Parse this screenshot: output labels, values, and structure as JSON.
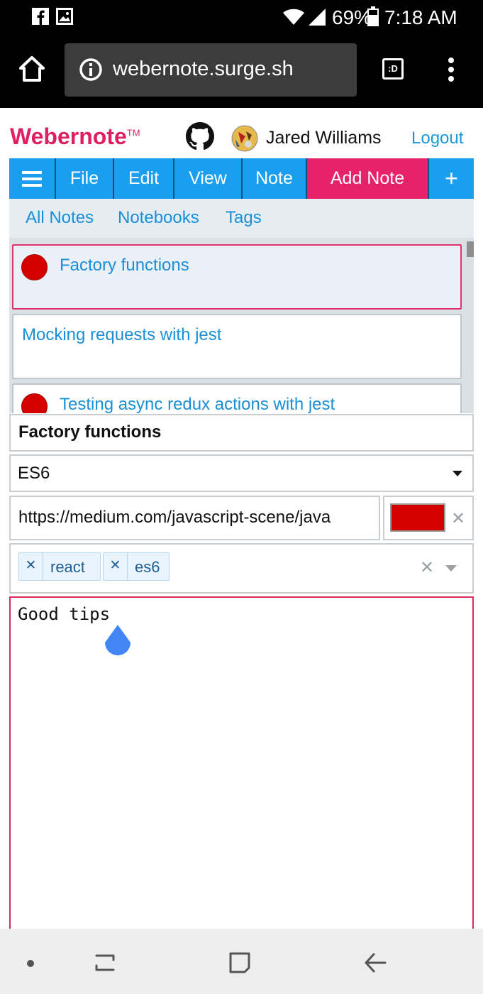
{
  "status_bar": {
    "battery": "69%",
    "time": "7:18 AM"
  },
  "browser": {
    "url": "webernote.surge.sh",
    "tab_icon": ":D"
  },
  "app": {
    "brand": "Webernote",
    "brand_tm": "TM",
    "user_name": "Jared Williams",
    "logout_label": "Logout"
  },
  "menu": {
    "file": "File",
    "edit": "Edit",
    "view": "View",
    "note": "Note",
    "add_note": "Add Note",
    "plus": "+"
  },
  "subnav": {
    "all_notes": "All Notes",
    "notebooks": "Notebooks",
    "tags": "Tags"
  },
  "notes": [
    {
      "title": "Factory functions",
      "color": "#d40000",
      "selected": true
    },
    {
      "title": "Mocking requests with jest",
      "color": null,
      "selected": false
    },
    {
      "title": "Testing async redux actions with jest",
      "color": "#d40000",
      "selected": false
    }
  ],
  "editor": {
    "title": "Factory functions",
    "notebook": "ES6",
    "url": "https://medium.com/javascript-scene/java",
    "color": "#d40000",
    "tags": [
      "react",
      "es6"
    ],
    "body": "Good tips"
  },
  "colors": {
    "accent_pink": "#e6226a",
    "accent_blue": "#1a9ff0",
    "link_blue": "#1a8fd6",
    "note_red": "#d40000"
  }
}
